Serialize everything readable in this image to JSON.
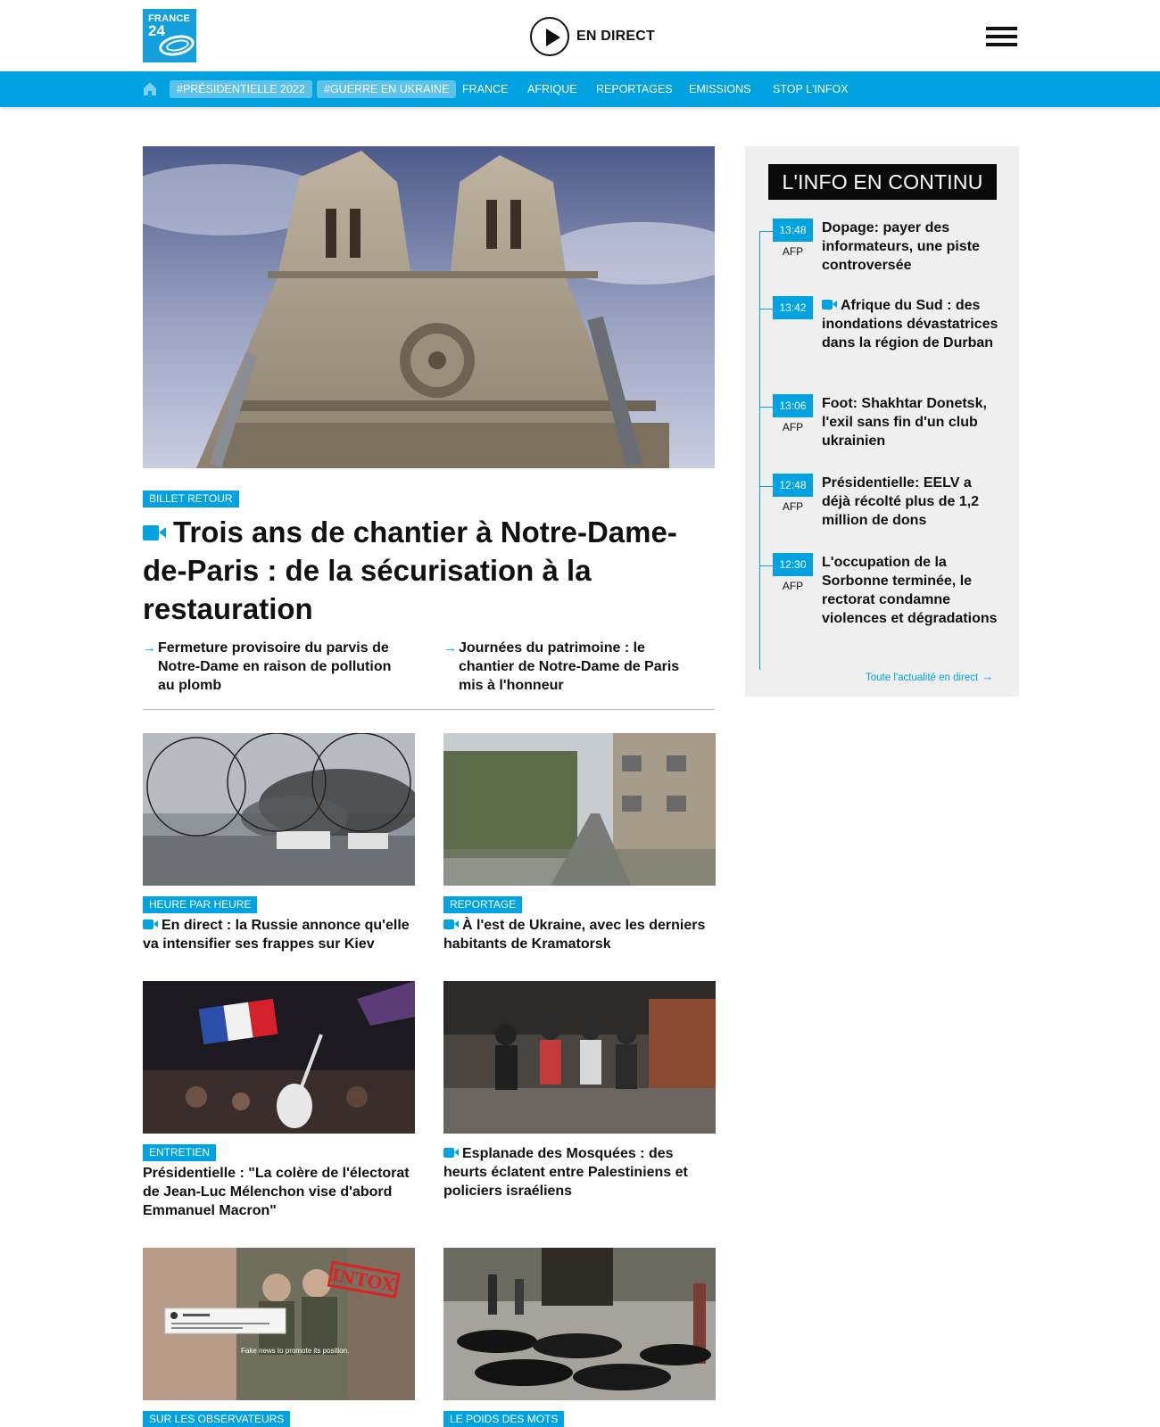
{
  "header": {
    "logo_line1": "FRANCE",
    "logo_line2": "24",
    "live_label": "EN DIRECT"
  },
  "nav": {
    "items": [
      {
        "label": "#PRÉSIDENTIELLE 2022",
        "highlight": true
      },
      {
        "label": "#GUERRE EN UKRAINE",
        "highlight": true
      },
      {
        "label": "FRANCE",
        "highlight": false
      },
      {
        "label": "AFRIQUE",
        "highlight": false
      },
      {
        "label": "REPORTAGES",
        "highlight": false
      },
      {
        "label": "EMISSIONS",
        "highlight": false
      },
      {
        "label": "STOP L'INFOX",
        "highlight": false
      }
    ]
  },
  "hero": {
    "tag": "BILLET RETOUR",
    "title": "Trois ans de chantier à Notre-Dame-de-Paris : de la sécurisation à la restauration",
    "related": [
      "Fermeture provisoire du parvis de Notre-Dame en raison de pollution au plomb",
      "Journées du patrimoine : le chantier de Notre-Dame de Paris mis à l'honneur"
    ]
  },
  "cards": [
    {
      "tag": "HEURE PAR HEURE",
      "title": "En direct : la Russie annonce qu'elle va intensifier ses frappes sur Kiev",
      "video": true
    },
    {
      "tag": "REPORTAGE",
      "title": "À l'est de Ukraine, avec les derniers habitants de Kramatorsk",
      "video": true
    },
    {
      "tag": "ENTRETIEN",
      "title": "Présidentielle : \"La colère de l'électorat de Jean-Luc Mélenchon vise d'abord Emmanuel Macron\"",
      "video": false
    },
    {
      "tag": "",
      "title": "Esplanade des Mosquées : des heurts éclatent entre Palestiniens et policiers israéliens",
      "video": true
    },
    {
      "tag": "SUR LES OBSERVATEURS",
      "title": "",
      "video": false
    },
    {
      "tag": "LE POIDS DES MOTS",
      "title": "",
      "video": false
    }
  ],
  "thumbnails": {
    "intox_stamp": "INTOX",
    "fake_news_caption": "Fake news to promote its position."
  },
  "sidebar": {
    "title": "L'INFO EN CONTINU",
    "items": [
      {
        "time": "13:48",
        "source": "AFP",
        "title": "Dopage: payer des informateurs, une piste controversée",
        "video": false
      },
      {
        "time": "13:42",
        "source": "",
        "title": "Afrique du Sud : des inondations dévastatrices dans la région de Durban",
        "video": true
      },
      {
        "time": "13:06",
        "source": "AFP",
        "title": "Foot: Shakhtar Donetsk, l'exil sans fin d'un club ukrainien",
        "video": false
      },
      {
        "time": "12:48",
        "source": "AFP",
        "title": "Présidentielle: EELV a déjà récolté plus de 1,2 million de dons",
        "video": false
      },
      {
        "time": "12:30",
        "source": "AFP",
        "title": "L'occupation de la Sorbonne terminée, le rectorat condamne violences et dégradations",
        "video": false
      }
    ],
    "more_link": "Toute l'actualité en direct"
  },
  "colors": {
    "accent": "#00a3e0",
    "nav_pill": "#5cc3ea",
    "sidebar_bg": "#efefef",
    "sidebar_head_bg": "#0a0a0a"
  },
  "icons": {
    "home": "home-icon",
    "live": "play-circle-icon",
    "menu": "hamburger-menu-icon",
    "video": "video-camera-icon",
    "arrow": "arrow-right-icon"
  }
}
